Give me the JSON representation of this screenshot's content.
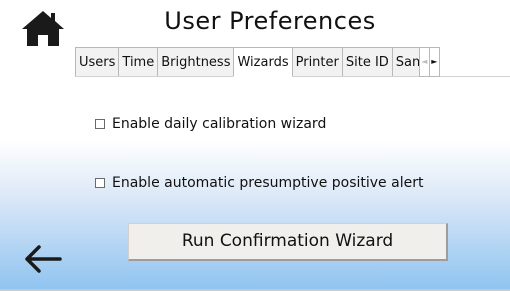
{
  "header": {
    "title": "User Preferences",
    "home_icon": "home-icon",
    "back_icon": "back-arrow-icon"
  },
  "tabs": {
    "items": [
      {
        "label": "Users",
        "active": false
      },
      {
        "label": "Time",
        "active": false
      },
      {
        "label": "Brightness",
        "active": false
      },
      {
        "label": "Wizards",
        "active": true
      },
      {
        "label": "Printer",
        "active": false
      },
      {
        "label": "Site ID",
        "active": false
      },
      {
        "label": "San",
        "active": false
      }
    ],
    "scroll_left_glyph": "◄",
    "scroll_right_glyph": "►"
  },
  "wizards": {
    "options": [
      {
        "label": "Enable daily calibration wizard",
        "checked": false
      },
      {
        "label": "Enable automatic presumptive positive alert",
        "checked": false
      }
    ],
    "run_button_label": "Run Confirmation Wizard"
  },
  "colors": {
    "background_top": "#ffffff",
    "background_bottom": "#8ec3f0",
    "button_face": "#f1efec"
  }
}
